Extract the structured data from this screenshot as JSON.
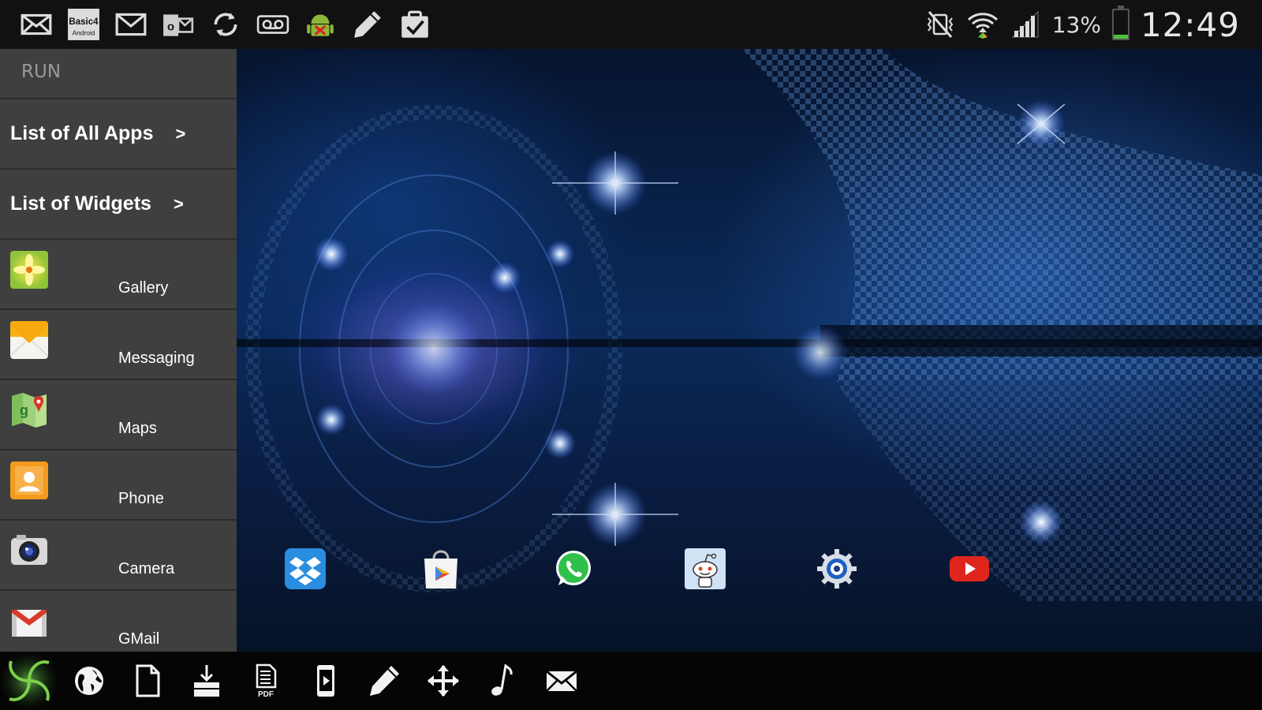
{
  "status_bar": {
    "notification_icons": [
      "mail-icon",
      "basic4android-icon",
      "gmail-icon",
      "outlook-icon",
      "sync-icon",
      "voicemail-icon",
      "android-debug-icon",
      "pencil-icon",
      "clipboard-check-icon"
    ],
    "basic4android_text": [
      "Basic4",
      "Android"
    ],
    "battery_percent": "13%",
    "battery_level": 0.13,
    "time": "12:49"
  },
  "side_panel": {
    "section_label": "RUN",
    "nav_items": [
      {
        "label": "List of All Apps",
        "chevron": ">"
      },
      {
        "label": "List of Widgets",
        "chevron": ">"
      }
    ],
    "apps": [
      {
        "label": "Gallery",
        "icon": "gallery-icon"
      },
      {
        "label": "Messaging",
        "icon": "messaging-icon"
      },
      {
        "label": "Maps",
        "icon": "maps-icon"
      },
      {
        "label": "Phone",
        "icon": "phone-icon"
      },
      {
        "label": "Camera",
        "icon": "camera-icon"
      },
      {
        "label": "GMail",
        "icon": "gmail-app-icon"
      }
    ]
  },
  "dock": {
    "icons": [
      "dropbox-icon",
      "play-store-icon",
      "whatsapp-icon",
      "reddit-icon",
      "settings-icon",
      "youtube-icon"
    ]
  },
  "bottom_bar": {
    "icons": [
      "launcher-logo-icon",
      "globe-icon",
      "document-icon",
      "download-icon",
      "pdf-icon",
      "mobile-icon",
      "pencil-icon",
      "move-icon",
      "music-icon",
      "mail-icon"
    ],
    "pdf_text": "PDF"
  },
  "colors": {
    "status_bar_bg": "#111111",
    "side_panel_bg": "#3f3f3f",
    "battery_fill": "#4cc23a",
    "wallpaper_blue": "#0a2a5a"
  }
}
